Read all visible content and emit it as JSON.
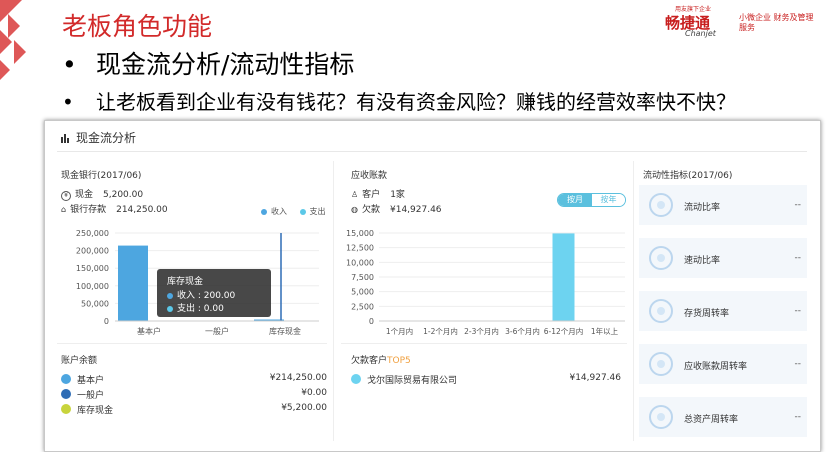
{
  "slide": {
    "title": "老板角色功能",
    "bullet1": "现金流分析/流动性指标",
    "bullet2": "让老板看到企业有没有钱花？有没有资金风险？赚钱的经营效率快不快？",
    "bullet_mark": "•"
  },
  "brand": {
    "name": "畅捷通",
    "name_en": "Chanjet",
    "slogan": "小微企业 财务及管理服务",
    "top_line": "用友旗下企业",
    "color": "#c81e1e"
  },
  "panel": {
    "title": "现金流分析",
    "cash": {
      "section_title": "现金银行(2017/06)",
      "cash_label": "现金",
      "cash_value": "5,200.00",
      "bank_label": "银行存款",
      "bank_value": "214,250.00",
      "legend_income": "收入",
      "legend_expense": "支出"
    },
    "receivables": {
      "section_title": "应收账款",
      "customers_label": "客户",
      "customers_value": "1家",
      "owed_label": "欠款",
      "owed_value": "¥14,927.46",
      "toggle_month": "按月",
      "toggle_year": "按年"
    },
    "liquidity": {
      "section_title": "流动性指标(2017/06)",
      "cards": [
        {
          "label": "流动比率",
          "value": "--",
          "icon": "liquidity-ratio-icon"
        },
        {
          "label": "速动比率",
          "value": "--",
          "icon": "rocket-icon"
        },
        {
          "label": "存货周转率",
          "value": "--",
          "icon": "inventory-box-icon"
        },
        {
          "label": "应收账款周转率",
          "value": "--",
          "icon": "yen-coin-icon"
        },
        {
          "label": "总资产周转率",
          "value": "--",
          "icon": "yen-bill-icon"
        }
      ]
    },
    "accounts": {
      "section_title": "账户余额",
      "rows": [
        {
          "label": "基本户",
          "value": "¥214,250.00",
          "color": "#4da6e0"
        },
        {
          "label": "一般户",
          "value": "¥0.00",
          "color": "#2e6cb5"
        },
        {
          "label": "库存现金",
          "value": "¥5,200.00",
          "color": "#c8d43c"
        }
      ]
    },
    "debtors": {
      "section_title": "欠款客户",
      "section_suffix": "TOP5",
      "rows": [
        {
          "label": "戈尔国际贸易有限公司",
          "value": "¥14,927.46"
        }
      ]
    },
    "tooltip": {
      "title": "库存现金",
      "income": "收入 : 200.00",
      "expense": "支出 : 0.00"
    }
  },
  "chart_data": [
    {
      "type": "bar",
      "categories": [
        "基本户",
        "一般户",
        "库存现金"
      ],
      "series": [
        {
          "name": "收入",
          "values": [
            214250,
            0,
            200
          ],
          "color": "#4da6e0"
        },
        {
          "name": "支出",
          "values": [
            0,
            0,
            0
          ],
          "color": "#5bc8e8"
        }
      ],
      "yticks": [
        "250,000",
        "200,000",
        "150,000",
        "100,000",
        "50,000",
        "0"
      ],
      "ylim": [
        0,
        250000
      ],
      "legend": "top-right"
    },
    {
      "type": "bar",
      "categories": [
        "1个月内",
        "1-2个月内",
        "2-3个月内",
        "3-6个月内",
        "6-12个月内",
        "1年以上"
      ],
      "values": [
        0,
        0,
        0,
        0,
        14927.46,
        0
      ],
      "color": "#6dd3f0",
      "yticks": [
        "15,000",
        "12,500",
        "10,000",
        "7,500",
        "5,000",
        "2,500",
        "0"
      ],
      "ylim": [
        0,
        15000
      ]
    }
  ]
}
